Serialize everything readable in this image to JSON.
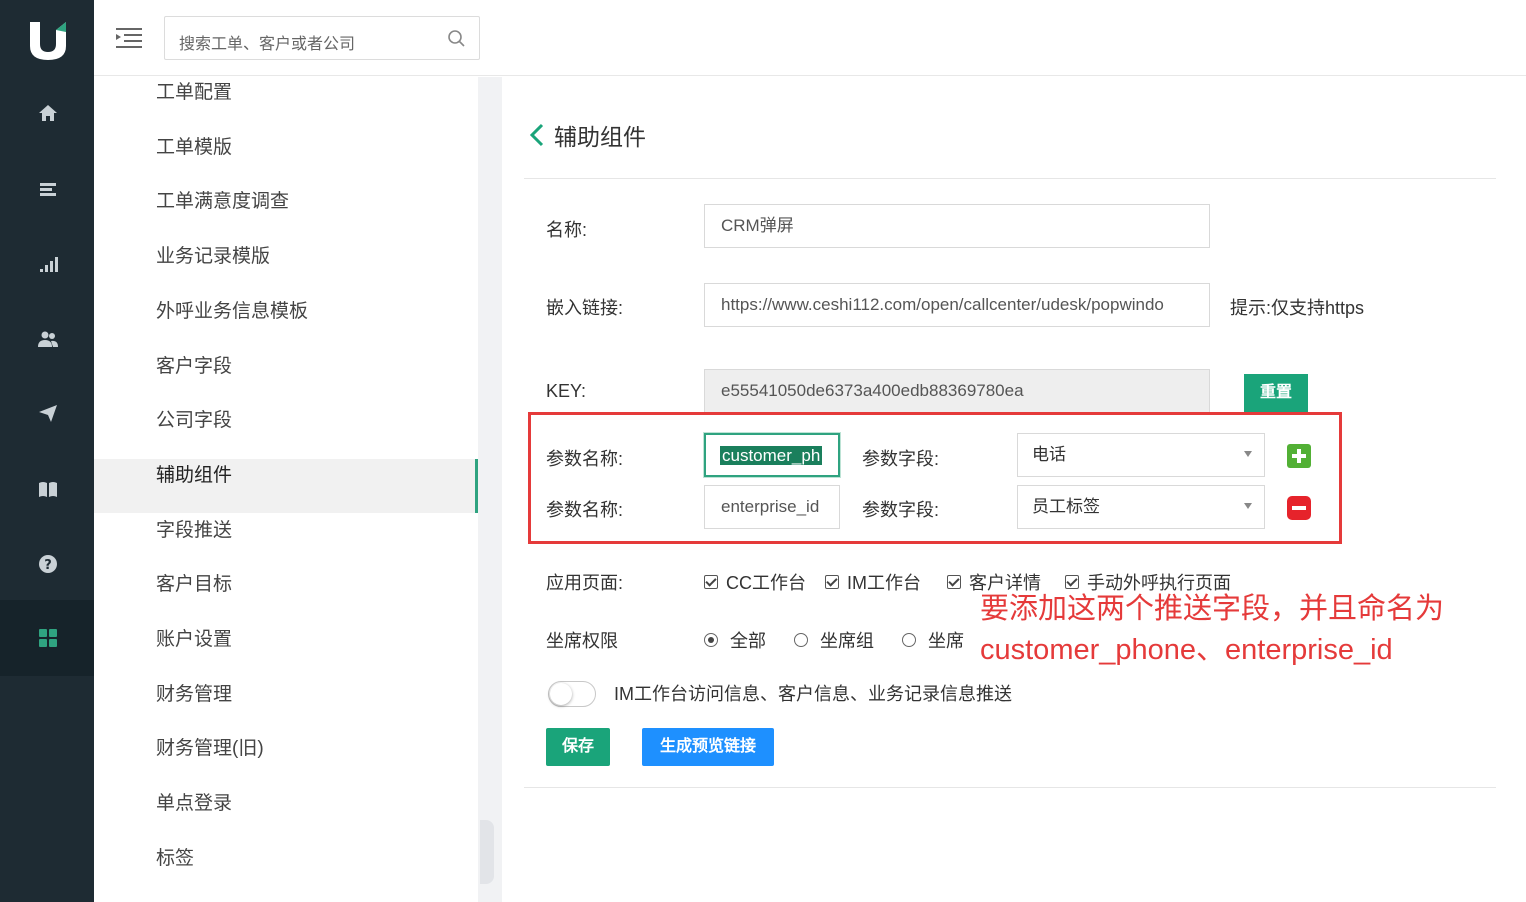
{
  "search": {
    "placeholder": "搜索工单、客户或者公司"
  },
  "subnav": {
    "items": [
      {
        "label": "工单配置"
      },
      {
        "label": "工单模版"
      },
      {
        "label": "工单满意度调查"
      },
      {
        "label": "业务记录模版"
      },
      {
        "label": "外呼业务信息模板"
      },
      {
        "label": "客户字段"
      },
      {
        "label": "公司字段"
      },
      {
        "label": "辅助组件",
        "active": true
      },
      {
        "label": "字段推送"
      },
      {
        "label": "客户目标"
      },
      {
        "label": "账户设置"
      },
      {
        "label": "财务管理"
      },
      {
        "label": "财务管理(旧)"
      },
      {
        "label": "单点登录"
      },
      {
        "label": "标签"
      }
    ]
  },
  "page": {
    "title": "辅助组件"
  },
  "form": {
    "name_label": "名称:",
    "name_value": "CRM弹屏",
    "link_label": "嵌入链接:",
    "link_value": "https://www.ceshi112.com/open/callcenter/udesk/popwindo",
    "link_hint": "提示:仅支持https",
    "key_label": "KEY:",
    "key_value": "e55541050de6373a400edb88369780ea",
    "reset_label": "重置",
    "params": [
      {
        "name_label": "参数名称:",
        "name_value": "customer_ph",
        "field_label": "参数字段:",
        "field_value": "电话",
        "action": "add"
      },
      {
        "name_label": "参数名称:",
        "name_value": "enterprise_id",
        "field_label": "参数字段:",
        "field_value": "员工标签",
        "action": "remove"
      }
    ],
    "apply_label": "应用页面:",
    "apply_options": [
      "CC工作台",
      "IM工作台",
      "客户详情",
      "手动外呼执行页面"
    ],
    "perm_label": "坐席权限",
    "perm_options": [
      "全部",
      "坐席组",
      "坐席"
    ],
    "perm_selected": "全部",
    "toggle_label": "IM工作台访问信息、客户信息、业务记录信息推送",
    "save_label": "保存",
    "preview_label": "生成预览链接"
  },
  "annotation": {
    "line1": "要添加这两个推送字段，并且命名为",
    "line2": "customer_phone、enterprise_id"
  },
  "colors": {
    "accent": "#1aa47a",
    "preview_blue": "#1e90ff",
    "annotation_red": "#e53a3a",
    "rail_bg": "#1e2b33"
  }
}
